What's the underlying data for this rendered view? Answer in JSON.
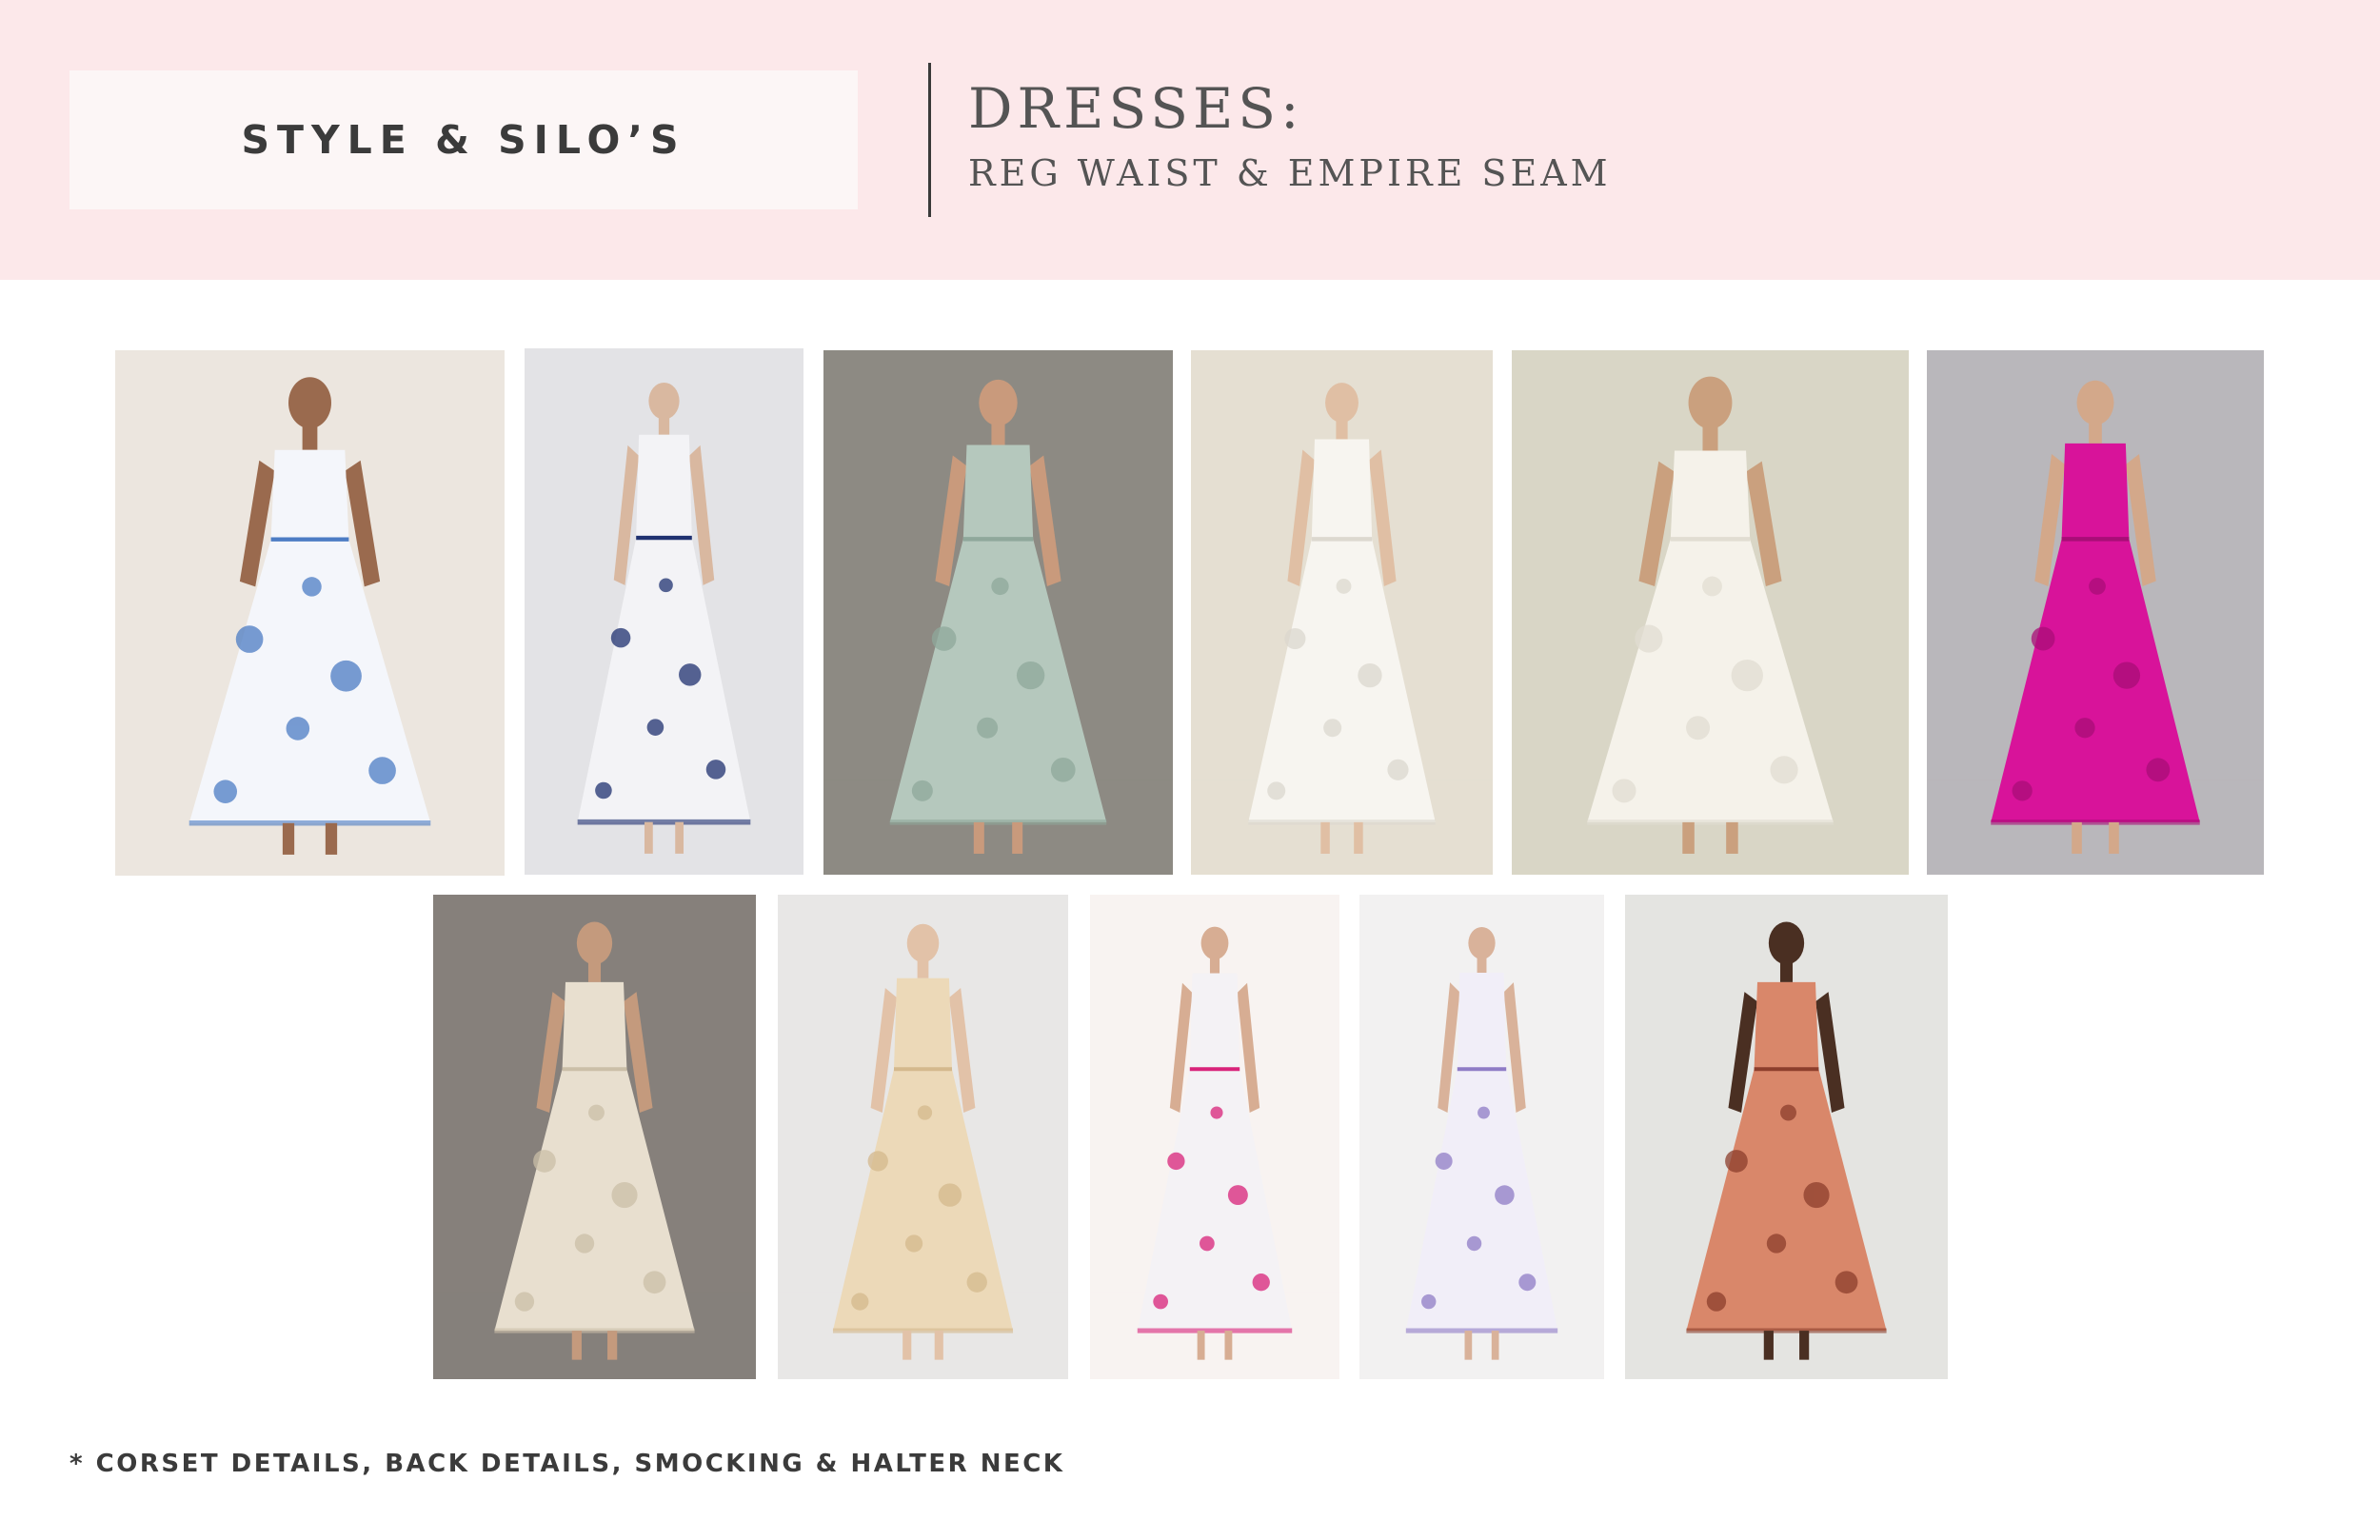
{
  "header": {
    "title": "STYLE & SILO’S",
    "section": "DRESSES:",
    "subtitle": "REG WAIST & EMPIRE SEAM"
  },
  "photos_row1": [
    {
      "name": "blue-floral-halter-dress-photo",
      "bg": "#ece6df",
      "dress": "#f4f6fb",
      "accent": "#4c7cc4",
      "skin": "#9a6a4e"
    },
    {
      "name": "navy-floral-halter-tiered-dress-photo",
      "bg": "#e3e3e6",
      "dress": "#f3f3f6",
      "accent": "#1f3170",
      "skin": "#d9b8a0"
    },
    {
      "name": "sage-green-eyelet-dress-photo",
      "bg": "#8d8a83",
      "dress": "#b5c8bd",
      "accent": "#8fa89b",
      "skin": "#c99a7c"
    },
    {
      "name": "white-eyelet-ruffle-strap-dress-photo",
      "bg": "#e5dfd2",
      "dress": "#f7f5f0",
      "accent": "#dcd8cf",
      "skin": "#e0bfa4"
    },
    {
      "name": "white-eyelet-open-back-dress-photo",
      "bg": "#d9d6c6",
      "dress": "#f5f2ea",
      "accent": "#e1ddd2",
      "skin": "#caa07e"
    },
    {
      "name": "magenta-midi-dress-photo",
      "bg": "#b9b7bb",
      "dress": "#d8139a",
      "accent": "#a90d77",
      "skin": "#d3a88a"
    }
  ],
  "photos_row2": [
    {
      "name": "cream-eyelet-pocket-dress-photo",
      "bg": "#86807b",
      "dress": "#e8dfcf",
      "accent": "#cbbfa8",
      "skin": "#c49a7d"
    },
    {
      "name": "beige-floral-tiered-dress-photo",
      "bg": "#e8e7e6",
      "dress": "#ecd9b8",
      "accent": "#d4b98d",
      "skin": "#e2c2a8"
    },
    {
      "name": "pink-floral-stripe-smocked-dress-photo",
      "bg": "#f8f3f1",
      "dress": "#f4f2f5",
      "accent": "#d8237a",
      "skin": "#d7ad93"
    },
    {
      "name": "lilac-floral-stripe-smocked-dress-photo",
      "bg": "#f2f1f1",
      "dress": "#f1eef8",
      "accent": "#8f7cc6",
      "skin": "#d9b29a"
    },
    {
      "name": "coral-print-off-shoulder-dress-photo",
      "bg": "#e4e4e1",
      "dress": "#d9876a",
      "accent": "#8c3e2c",
      "skin": "#4a2f22"
    }
  ],
  "footnote": "* CORSET DETAILS, BACK DETAILS, SMOCKING & HALTER NECK"
}
